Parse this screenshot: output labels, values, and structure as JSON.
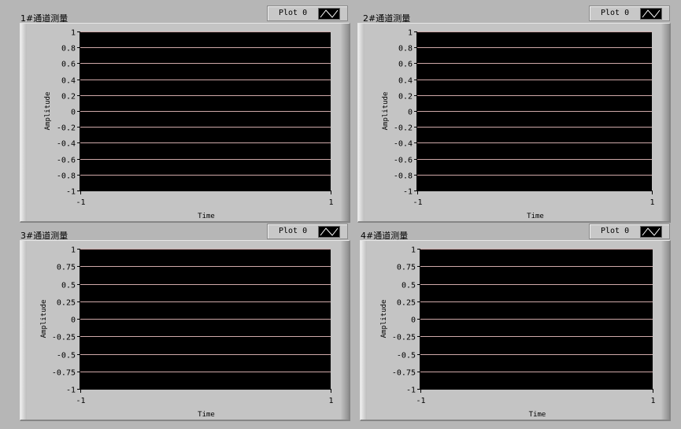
{
  "graphs": [
    {
      "label": "1#通道测量",
      "legend": {
        "plot_name": "Plot 0",
        "swatch_icon": "sine-wave-icon"
      },
      "chart_data": {
        "type": "line",
        "xlabel": "Time",
        "ylabel": "Amplitude",
        "xlim": [
          -1,
          1
        ],
        "ylim": [
          -1,
          1
        ],
        "x_ticks": [
          "-1",
          "1"
        ],
        "y_ticks": [
          "1",
          "0.8",
          "0.6",
          "0.4",
          "0.2",
          "0",
          "-0.2",
          "-0.4",
          "-0.6",
          "-0.8",
          "-1"
        ],
        "grid": true,
        "series": [
          {
            "name": "Plot 0",
            "x": [],
            "y": []
          }
        ],
        "plot_background": "#000000",
        "grid_color": "#cfa9a9"
      }
    },
    {
      "label": "2#通道测量",
      "legend": {
        "plot_name": "Plot 0",
        "swatch_icon": "sine-wave-icon"
      },
      "chart_data": {
        "type": "line",
        "xlabel": "Time",
        "ylabel": "Amplitude",
        "xlim": [
          -1,
          1
        ],
        "ylim": [
          -1,
          1
        ],
        "x_ticks": [
          "-1",
          "1"
        ],
        "y_ticks": [
          "1",
          "0.8",
          "0.6",
          "0.4",
          "0.2",
          "0",
          "-0.2",
          "-0.4",
          "-0.6",
          "-0.8",
          "-1"
        ],
        "grid": true,
        "series": [
          {
            "name": "Plot 0",
            "x": [],
            "y": []
          }
        ],
        "plot_background": "#000000",
        "grid_color": "#cfa9a9"
      }
    },
    {
      "label": "3#通道测量",
      "legend": {
        "plot_name": "Plot 0",
        "swatch_icon": "sine-wave-icon"
      },
      "chart_data": {
        "type": "line",
        "xlabel": "Time",
        "ylabel": "Amplitude",
        "xlim": [
          -1,
          1
        ],
        "ylim": [
          -1,
          1
        ],
        "x_ticks": [
          "-1",
          "1"
        ],
        "y_ticks": [
          "1",
          "0.75",
          "0.5",
          "0.25",
          "0",
          "-0.25",
          "-0.5",
          "-0.75",
          "-1"
        ],
        "grid": true,
        "series": [
          {
            "name": "Plot 0",
            "x": [],
            "y": []
          }
        ],
        "plot_background": "#000000",
        "grid_color": "#cfa9a9"
      }
    },
    {
      "label": "4#通道测量",
      "legend": {
        "plot_name": "Plot 0",
        "swatch_icon": "sine-wave-icon"
      },
      "chart_data": {
        "type": "line",
        "xlabel": "Time",
        "ylabel": "Amplitude",
        "xlim": [
          -1,
          1
        ],
        "ylim": [
          -1,
          1
        ],
        "x_ticks": [
          "-1",
          "1"
        ],
        "y_ticks": [
          "1",
          "0.75",
          "0.5",
          "0.25",
          "0",
          "-0.25",
          "-0.5",
          "-0.75",
          "-1"
        ],
        "grid": true,
        "series": [
          {
            "name": "Plot 0",
            "x": [],
            "y": []
          }
        ],
        "plot_background": "#000000",
        "grid_color": "#cfa9a9"
      }
    }
  ]
}
